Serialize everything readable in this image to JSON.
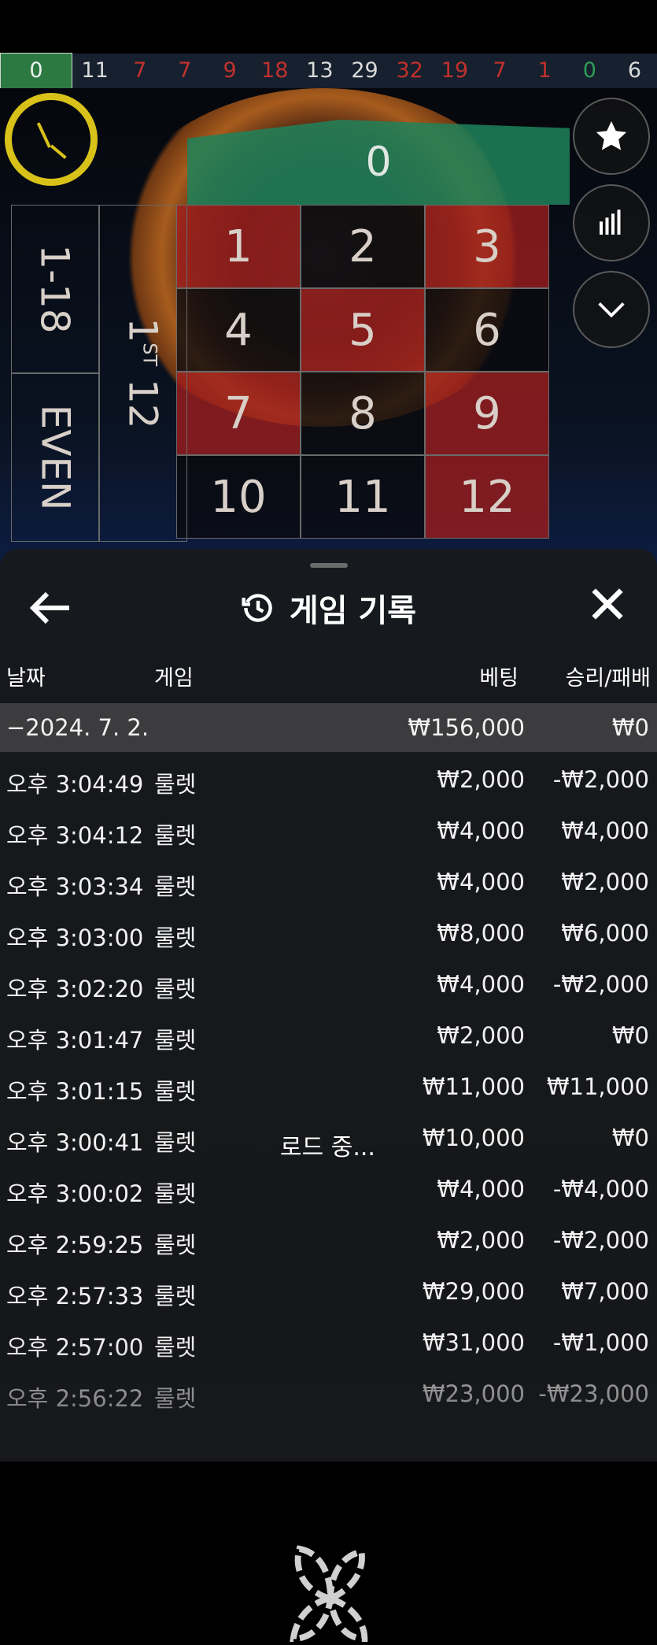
{
  "history": {
    "numbers": [
      {
        "value": "0",
        "color": "#eaf3ee"
      },
      {
        "value": "11",
        "color": "#d9d9d9"
      },
      {
        "value": "7",
        "color": "#c0312d"
      },
      {
        "value": "7",
        "color": "#c0312d"
      },
      {
        "value": "9",
        "color": "#c0312d"
      },
      {
        "value": "18",
        "color": "#c0312d"
      },
      {
        "value": "13",
        "color": "#d9d9d9"
      },
      {
        "value": "29",
        "color": "#d9d9d9"
      },
      {
        "value": "32",
        "color": "#c0312d"
      },
      {
        "value": "19",
        "color": "#c0312d"
      },
      {
        "value": "7",
        "color": "#c0312d"
      },
      {
        "value": "1",
        "color": "#c0312d"
      },
      {
        "value": "0",
        "color": "#2f9d55"
      },
      {
        "value": "6",
        "color": "#d9d9d9"
      }
    ]
  },
  "table": {
    "zero": "0",
    "low": "1-18",
    "even": "EVEN",
    "dozen_num": "1",
    "dozen_sup": "ST",
    "dozen_tail": "12",
    "numbers": [
      {
        "n": "1",
        "c": "red"
      },
      {
        "n": "2",
        "c": "black"
      },
      {
        "n": "3",
        "c": "red"
      },
      {
        "n": "4",
        "c": "black"
      },
      {
        "n": "5",
        "c": "red"
      },
      {
        "n": "6",
        "c": "black"
      },
      {
        "n": "7",
        "c": "red"
      },
      {
        "n": "8",
        "c": "black"
      },
      {
        "n": "9",
        "c": "red"
      },
      {
        "n": "10",
        "c": "black"
      },
      {
        "n": "11",
        "c": "black"
      },
      {
        "n": "12",
        "c": "red"
      }
    ]
  },
  "right_buttons": [
    "star-icon",
    "stats-icon",
    "chevron-down-icon"
  ],
  "panel": {
    "title": "게임 기록",
    "back_icon": "arrow-left-icon",
    "history_icon": "history-icon",
    "close_icon": "close-icon",
    "headers": {
      "date": "날짜",
      "game": "게임",
      "bet": "베팅",
      "result": "승리/패배"
    },
    "date_group": {
      "date": "−2024. 7. 2.",
      "bet": "₩156,000",
      "result": "₩0"
    },
    "rows": [
      {
        "time": "오후 3:04:49",
        "game": "룰렛",
        "bet": "₩2,000",
        "result": "-₩2,000"
      },
      {
        "time": "오후 3:04:12",
        "game": "룰렛",
        "bet": "₩4,000",
        "result": "₩4,000"
      },
      {
        "time": "오후 3:03:34",
        "game": "룰렛",
        "bet": "₩4,000",
        "result": "₩2,000"
      },
      {
        "time": "오후 3:03:00",
        "game": "룰렛",
        "bet": "₩8,000",
        "result": "₩6,000"
      },
      {
        "time": "오후 3:02:20",
        "game": "룰렛",
        "bet": "₩4,000",
        "result": "-₩2,000"
      },
      {
        "time": "오후 3:01:47",
        "game": "룰렛",
        "bet": "₩2,000",
        "result": "₩0"
      },
      {
        "time": "오후 3:01:15",
        "game": "룰렛",
        "bet": "₩11,000",
        "result": "₩11,000"
      },
      {
        "time": "오후 3:00:41",
        "game": "룰렛",
        "bet": "₩10,000",
        "result": "₩0"
      },
      {
        "time": "오후 3:00:02",
        "game": "룰렛",
        "bet": "₩4,000",
        "result": "-₩4,000"
      },
      {
        "time": "오후 2:59:25",
        "game": "룰렛",
        "bet": "₩2,000",
        "result": "-₩2,000"
      },
      {
        "time": "오후 2:57:33",
        "game": "룰렛",
        "bet": "₩29,000",
        "result": "₩7,000"
      },
      {
        "time": "오후 2:57:00",
        "game": "룰렛",
        "bet": "₩31,000",
        "result": "-₩1,000"
      },
      {
        "time": "오후 2:56:22",
        "game": "룰렛",
        "bet": "₩23,000",
        "result": "-₩23,000"
      }
    ],
    "loading_text": "로드 중..."
  }
}
